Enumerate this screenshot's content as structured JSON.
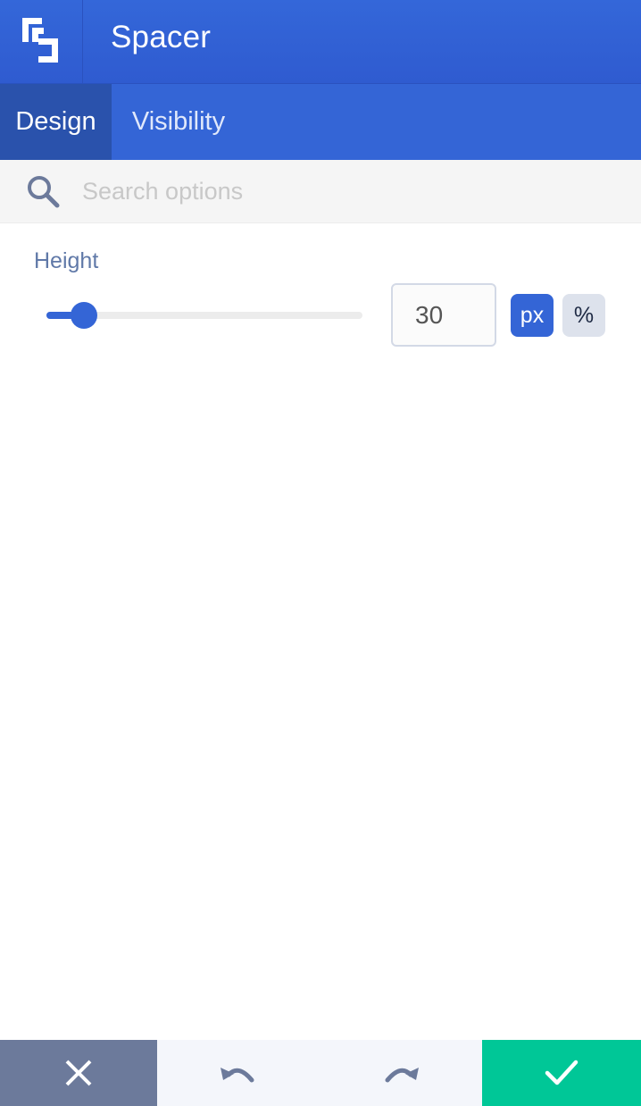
{
  "header": {
    "title": "Spacer",
    "logo_icon": "logo-icon"
  },
  "tabs": [
    {
      "label": "Design",
      "active": true
    },
    {
      "label": "Visibility",
      "active": false
    }
  ],
  "search": {
    "placeholder": "Search options",
    "value": "",
    "icon": "search-icon"
  },
  "height_field": {
    "label": "Height",
    "value": "30",
    "slider_fraction": 0.05,
    "units": [
      {
        "label": "px",
        "active": true
      },
      {
        "label": "%",
        "active": false
      }
    ]
  },
  "footer": {
    "cancel_icon": "close-icon",
    "undo_icon": "undo-icon",
    "redo_icon": "redo-icon",
    "confirm_icon": "check-icon"
  },
  "colors": {
    "primary": "#3465d6",
    "active_tab": "#2a52ac",
    "cancel": "#6c7a9b",
    "confirm": "#00c797",
    "label": "#6079a8"
  }
}
